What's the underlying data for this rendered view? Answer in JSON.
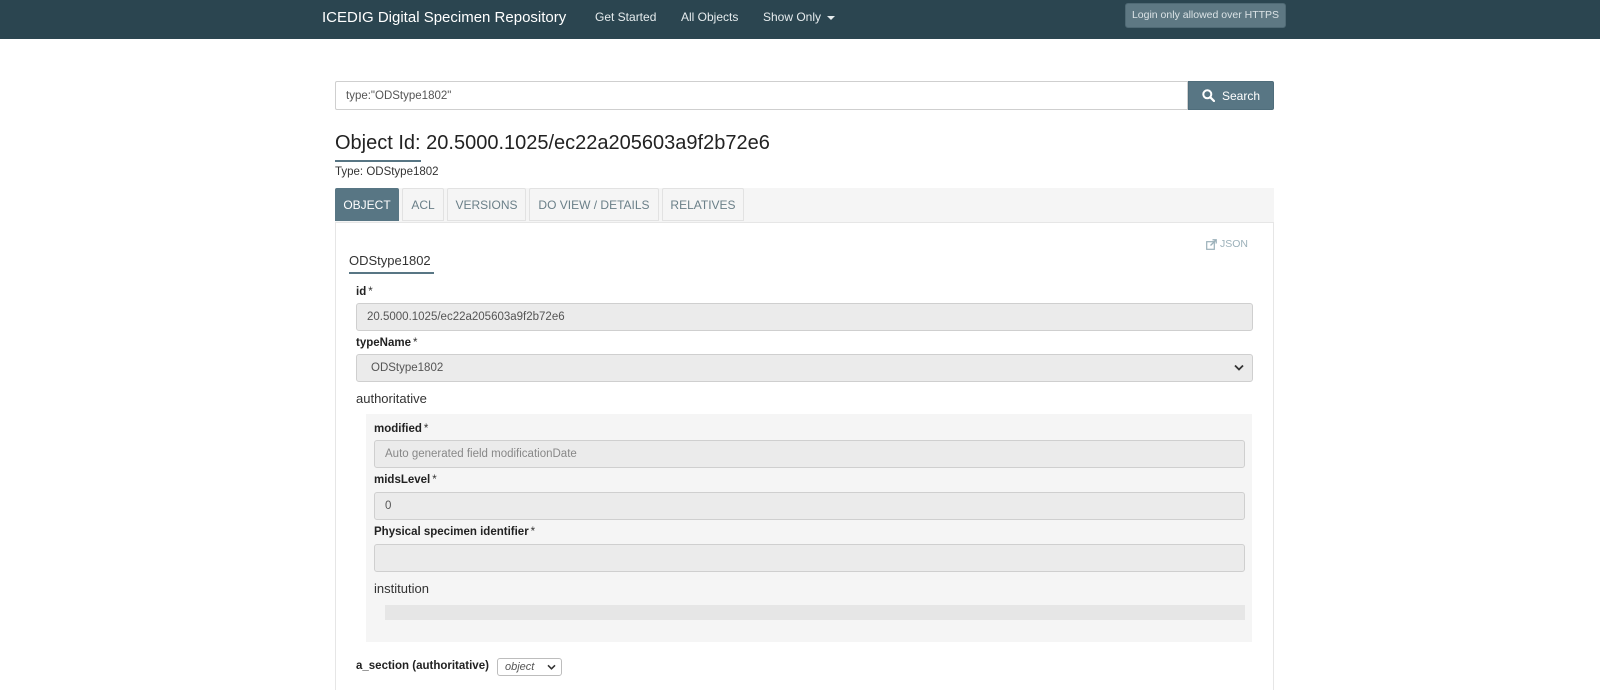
{
  "navbar": {
    "brand": "ICEDIG Digital Specimen Repository",
    "links": [
      "Get Started",
      "All Objects",
      "Show Only"
    ],
    "login_button": "Login only allowed over HTTPS"
  },
  "search": {
    "value": "type:\"ODStype1802\"",
    "button_label": "Search"
  },
  "object": {
    "title": "Object Id: 20.5000.1025/ec22a205603a9f2b72e6",
    "type_line": "Type: ODStype1802"
  },
  "tabs": [
    "OBJECT",
    "ACL",
    "VERSIONS",
    "DO VIEW / DETAILS",
    "RELATIVES"
  ],
  "active_tab": "OBJECT",
  "panel": {
    "json_link": "JSON",
    "section_title": "ODStype1802",
    "required_marker": "*",
    "fields": {
      "id": {
        "label": "id",
        "value": "20.5000.1025/ec22a205603a9f2b72e6"
      },
      "typeName": {
        "label": "typeName",
        "value": "ODStype1802"
      }
    },
    "authoritative": {
      "heading": "authoritative",
      "modified": {
        "label": "modified",
        "placeholder": "Auto generated field modificationDate"
      },
      "midsLevel": {
        "label": "midsLevel",
        "value": "0"
      },
      "physical_specimen_identifier": {
        "label": "Physical specimen identifier",
        "value": ""
      },
      "institution_heading": "institution"
    },
    "a_section": {
      "label": "a_section (authoritative)",
      "selected": "object"
    }
  },
  "colors": {
    "navbar_bg": "#2b4550",
    "accent": "#587684",
    "field_bg": "#ebebeb",
    "inner_panel_bg": "#f5f5f5"
  },
  "icons": [
    "search-icon",
    "caret-down-icon",
    "external-link-icon",
    "chevron-down-icon"
  ]
}
